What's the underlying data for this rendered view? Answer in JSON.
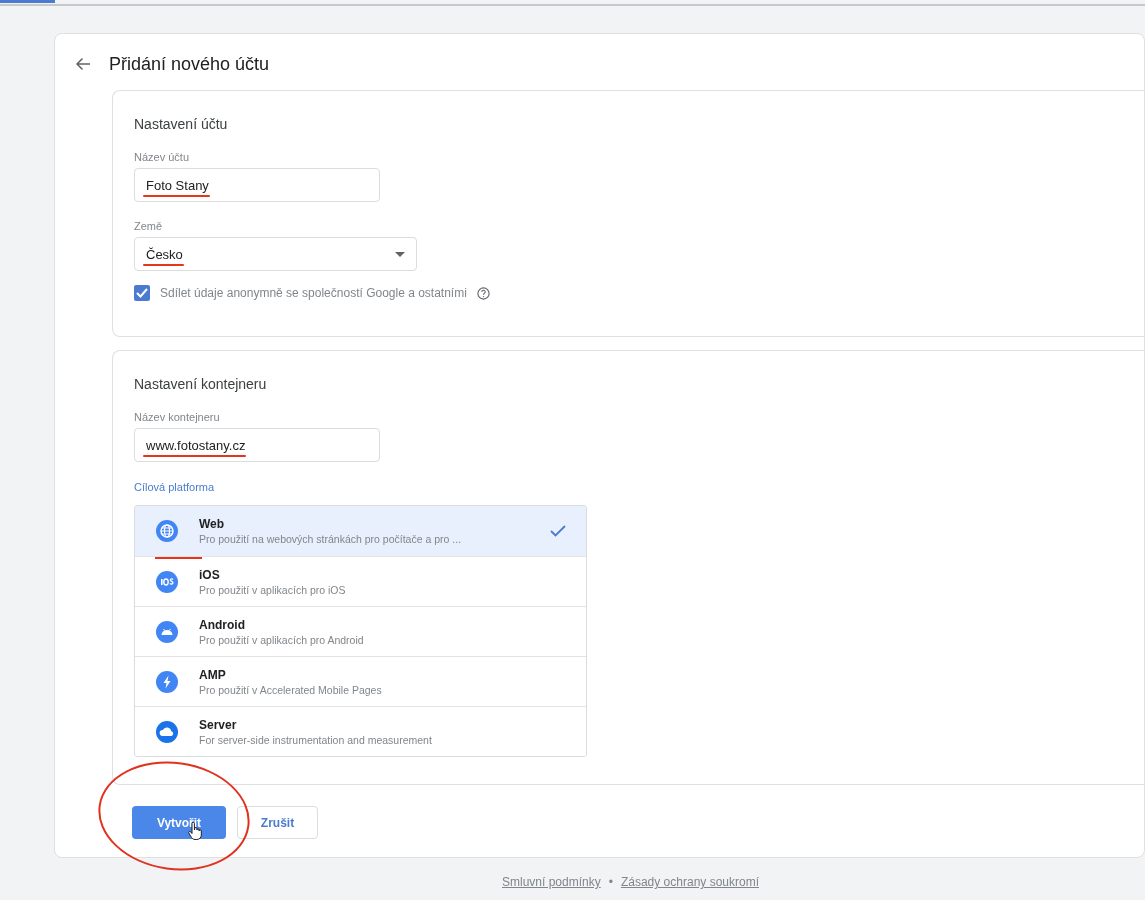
{
  "header": {
    "title": "Přidání nového účtu"
  },
  "account_settings": {
    "title": "Nastavení účtu",
    "account_name": {
      "label": "Název účtu",
      "value": "Foto Stany",
      "underlined": true
    },
    "country": {
      "label": "Země",
      "value": "Česko",
      "underlined": true
    },
    "share_data": {
      "label": "Sdílet údaje anonymně se společností Google a ostatními",
      "checked": true
    }
  },
  "container_settings": {
    "title": "Nastavení kontejneru",
    "container_name": {
      "label": "Název kontejneru",
      "value": "www.fotostany.cz",
      "underlined": true
    },
    "platform_label": "Cílová platforma",
    "platforms": [
      {
        "kind": "web",
        "name": "Web",
        "description": "Pro použití na webových stránkách pro počítače a pro ...",
        "selected": true,
        "underlined": true
      },
      {
        "kind": "ios",
        "name": "iOS",
        "description": "Pro použití v aplikacích pro iOS",
        "selected": false,
        "underlined": false
      },
      {
        "kind": "android",
        "name": "Android",
        "description": "Pro použití v aplikacích pro Android",
        "selected": false,
        "underlined": false
      },
      {
        "kind": "amp",
        "name": "AMP",
        "description": "Pro použití v Accelerated Mobile Pages",
        "selected": false,
        "underlined": false
      },
      {
        "kind": "server",
        "name": "Server",
        "description": "For server-side instrumentation and measurement",
        "selected": false,
        "underlined": false
      }
    ]
  },
  "buttons": [
    {
      "kind": "primary",
      "label": "Vytvořit",
      "circled": true
    },
    {
      "kind": "secondary",
      "label": "Zrušit",
      "circled": false
    }
  ],
  "footer": {
    "links": [
      "Smluvní podmínky",
      "Zásady ochrany soukromí"
    ],
    "separator": "•"
  }
}
